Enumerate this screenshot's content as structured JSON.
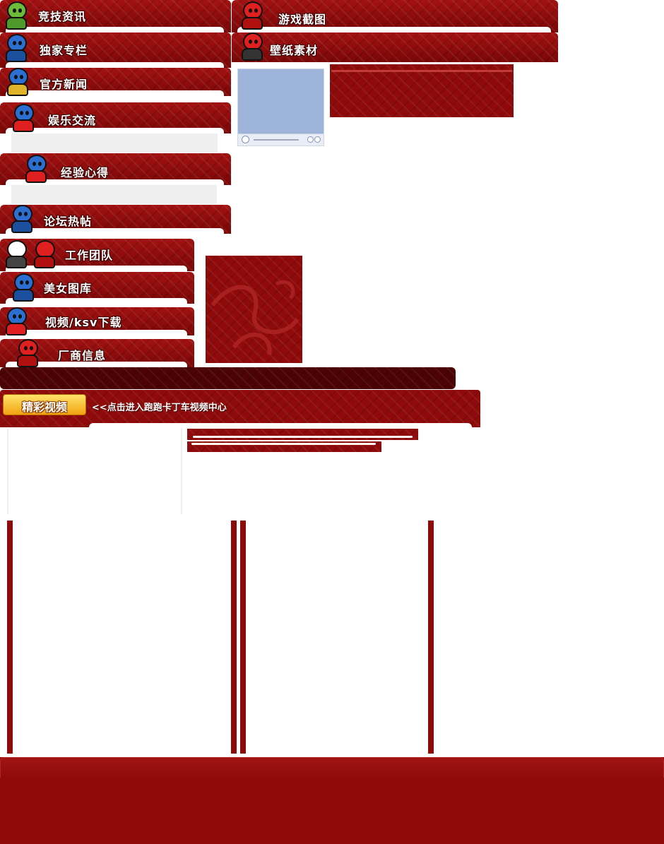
{
  "left_nav": [
    {
      "label": "竞技资讯",
      "icon": "green-helmet-racer-icon"
    },
    {
      "label": "独家专栏",
      "icon": "blue-ninja-icon"
    },
    {
      "label": "官方新闻",
      "icon": "blue-racer-kart-icon"
    },
    {
      "label": "娱乐交流",
      "icon": "red-kart-racer-icon"
    },
    {
      "label": "经验心得",
      "icon": "blue-racer-kart-icon"
    },
    {
      "label": "论坛热帖",
      "icon": "blue-ninja-kart-icon"
    },
    {
      "label": "工作团队",
      "icon": "panda-and-red-ninja-icon"
    },
    {
      "label": "美女图库",
      "icon": "blue-ninja-icon"
    },
    {
      "label": "视频/ksv下载",
      "icon": "blue-racer-red-kart-icon"
    },
    {
      "label": "厂商信息",
      "icon": "red-ninja-racer-icon"
    }
  ],
  "right_nav": [
    {
      "label": "游戏截图",
      "icon": "red-ninja-icon"
    },
    {
      "label": "壁纸素材",
      "icon": "red-ninja-kart-icon"
    }
  ],
  "video_section": {
    "header_label": "精彩视频",
    "link_text": "<<点击进入跑跑卡丁车视频中心"
  },
  "colors": {
    "brand_red": "#8f0b0b",
    "dark_red": "#5a0303",
    "player_blue": "#9fb4da",
    "highlight_yellow": "#f2a310"
  }
}
